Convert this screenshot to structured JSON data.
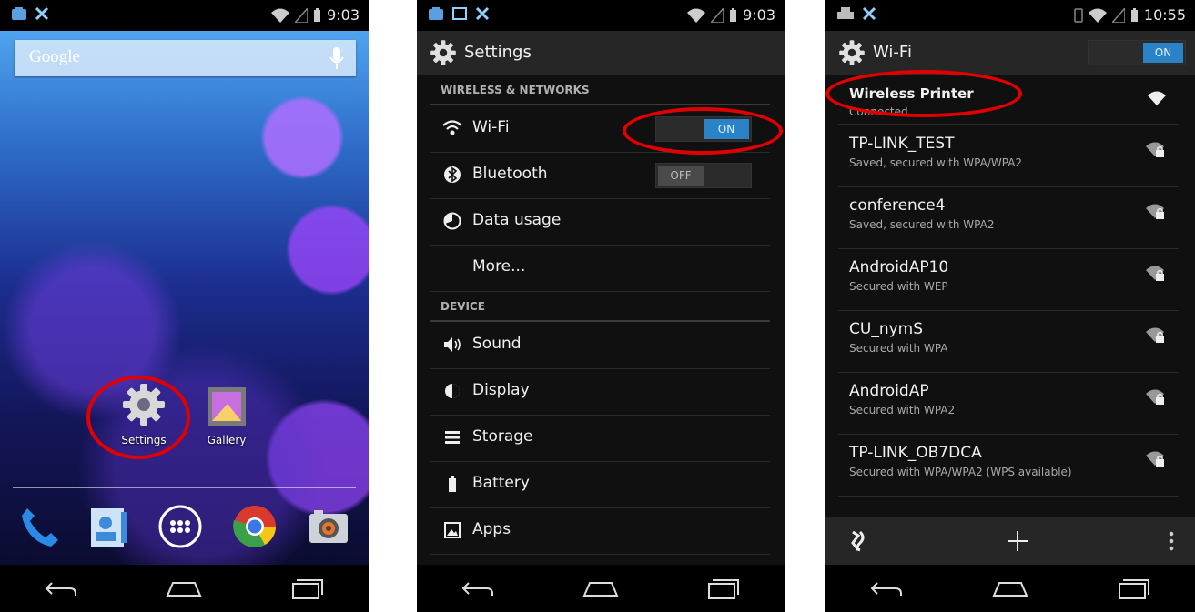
{
  "colors": {
    "highlight": "#e00000",
    "toggle_on": "#2a83c7",
    "action_bar": "#262626",
    "list_bg": "#101010"
  },
  "phone1": {
    "status_time": "9:03",
    "search": {
      "label": "Google"
    },
    "apps": [
      {
        "label": "Settings",
        "icon": "gear-icon"
      },
      {
        "label": "Gallery",
        "icon": "gallery-icon"
      }
    ],
    "dock": [
      "phone-icon",
      "contacts-icon",
      "app-drawer-icon",
      "chrome-icon",
      "camera-icon"
    ]
  },
  "phone2": {
    "status_time": "9:03",
    "title": "Settings",
    "sections": {
      "wireless": "WIRELESS & NETWORKS",
      "device": "DEVICE"
    },
    "items": [
      {
        "label": "Wi-Fi",
        "toggle": "ON"
      },
      {
        "label": "Bluetooth",
        "toggle": "OFF"
      },
      {
        "label": "Data usage"
      },
      {
        "label": "More..."
      },
      {
        "label": "Sound"
      },
      {
        "label": "Display"
      },
      {
        "label": "Storage"
      },
      {
        "label": "Battery"
      },
      {
        "label": "Apps"
      }
    ]
  },
  "phone3": {
    "status_time": "10:55",
    "title": "Wi-Fi",
    "toggle": "ON",
    "networks": [
      {
        "name": "Wireless Printer",
        "status": "Connected"
      },
      {
        "name": "TP-LINK_TEST",
        "status": "Saved, secured with WPA/WPA2"
      },
      {
        "name": "conference4",
        "status": "Saved, secured with WPA2"
      },
      {
        "name": "AndroidAP10",
        "status": "Secured with WEP"
      },
      {
        "name": "CU_nymS",
        "status": "Secured with WPA"
      },
      {
        "name": "AndroidAP",
        "status": "Secured with WPA2"
      },
      {
        "name": "TP-LINK_OB7DCA",
        "status": "Secured with WPA/WPA2 (WPS available)"
      }
    ],
    "bottom_actions": [
      "wps-icon",
      "add-network-icon",
      "overflow-menu-icon"
    ]
  }
}
